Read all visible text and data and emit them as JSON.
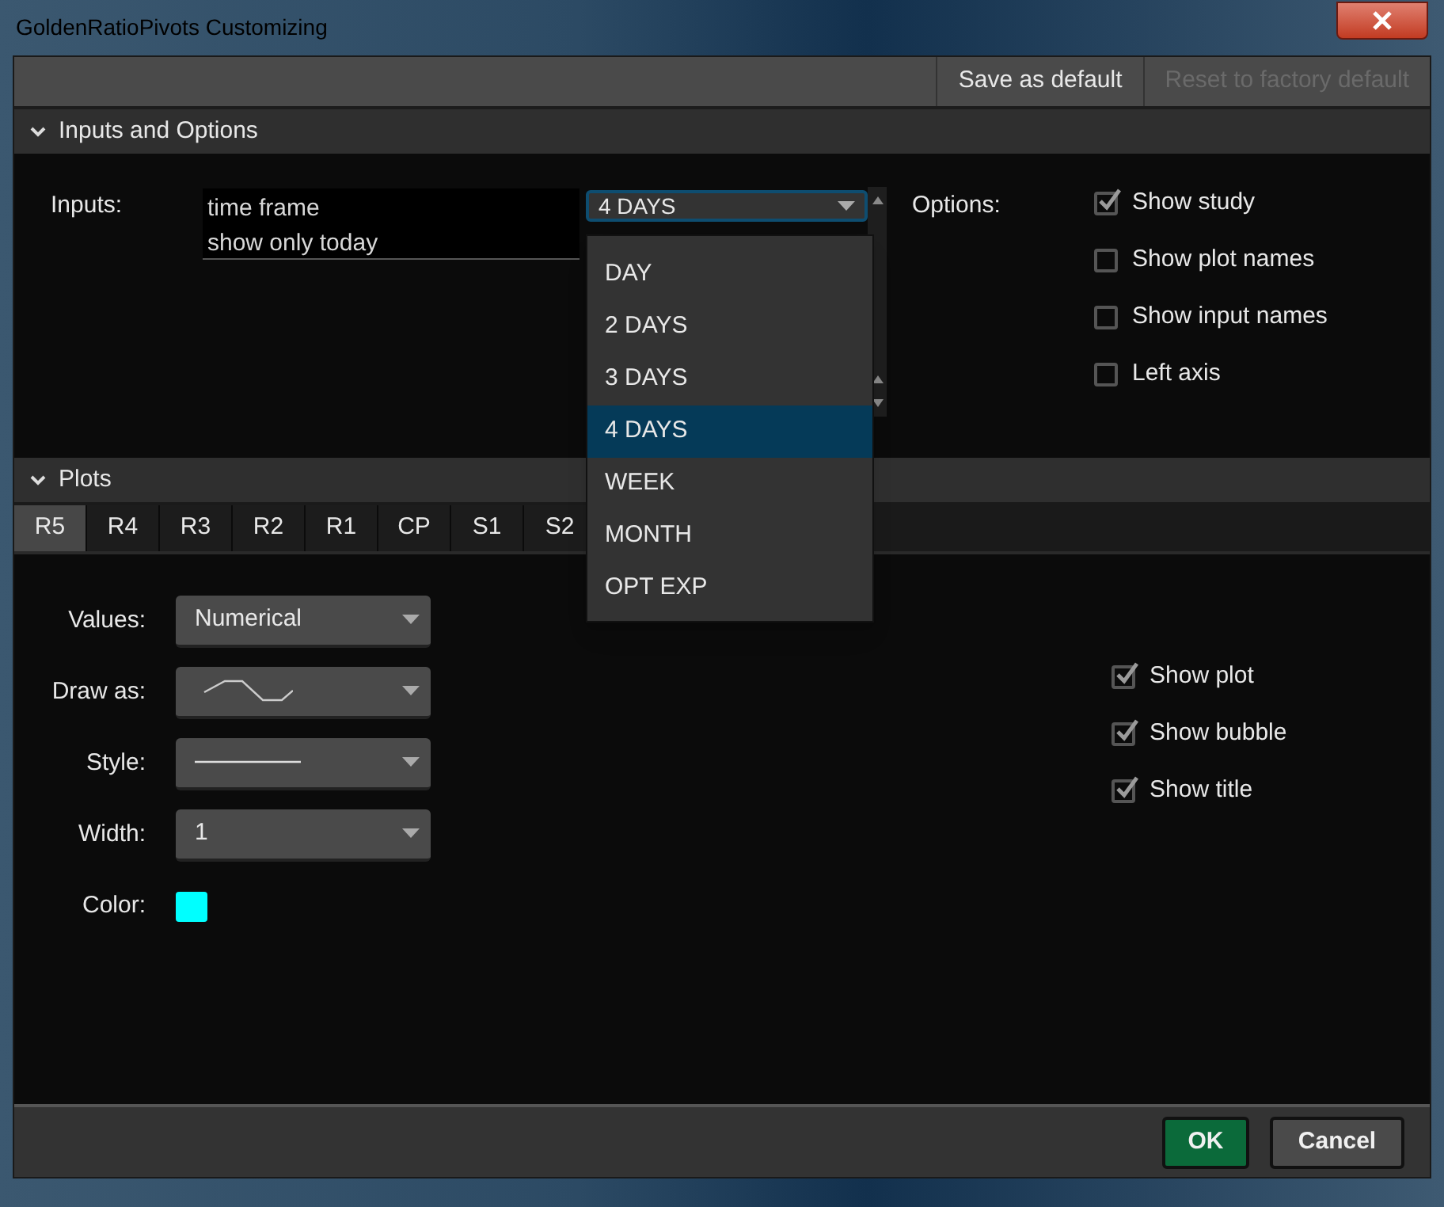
{
  "window": {
    "title": "GoldenRatioPivots Customizing"
  },
  "toolbar": [
    {
      "label": "Save as default",
      "disabled": false
    },
    {
      "label": "Reset to factory default",
      "disabled": true
    }
  ],
  "inputs_section": {
    "title": "Inputs and Options",
    "expanded": true,
    "inputs_label": "Inputs:",
    "inputs": [
      {
        "name": "time frame"
      },
      {
        "name": "show only today"
      }
    ],
    "time_frame_value": "4 DAYS",
    "time_frame_options": [
      {
        "label": "DAY",
        "selected": false
      },
      {
        "label": "2 DAYS",
        "selected": false
      },
      {
        "label": "3 DAYS",
        "selected": false
      },
      {
        "label": "4 DAYS",
        "selected": true
      },
      {
        "label": "WEEK",
        "selected": false
      },
      {
        "label": "MONTH",
        "selected": false
      },
      {
        "label": "OPT EXP",
        "selected": false
      }
    ],
    "options_label": "Options:",
    "options": [
      {
        "label": "Show study",
        "checked": true
      },
      {
        "label": "Show plot names",
        "checked": false
      },
      {
        "label": "Show input names",
        "checked": false
      },
      {
        "label": "Left axis",
        "checked": false
      }
    ]
  },
  "plots_section": {
    "title": "Plots",
    "expanded": true,
    "tabs": [
      {
        "label": "R5",
        "selected": true
      },
      {
        "label": "R4",
        "selected": false
      },
      {
        "label": "R3",
        "selected": false
      },
      {
        "label": "R2",
        "selected": false
      },
      {
        "label": "R1",
        "selected": false
      },
      {
        "label": "CP",
        "selected": false
      },
      {
        "label": "S1",
        "selected": false
      },
      {
        "label": "S2",
        "selected": false
      }
    ],
    "settings": [
      {
        "label": "Values:",
        "kind": "text",
        "value": "Numerical"
      },
      {
        "label": "Draw as:",
        "kind": "curve"
      },
      {
        "label": "Style:",
        "kind": "line"
      },
      {
        "label": "Width:",
        "kind": "text",
        "value": "1"
      },
      {
        "label": "Color:",
        "kind": "swatch",
        "color": "#00ffff"
      }
    ],
    "checks": [
      {
        "label": "Show plot",
        "checked": true
      },
      {
        "label": "Show bubble",
        "checked": true
      },
      {
        "label": "Show title",
        "checked": true
      }
    ]
  },
  "buttons": [
    {
      "label": "OK",
      "kind": "primary"
    },
    {
      "label": "Cancel",
      "kind": "secondary"
    }
  ]
}
